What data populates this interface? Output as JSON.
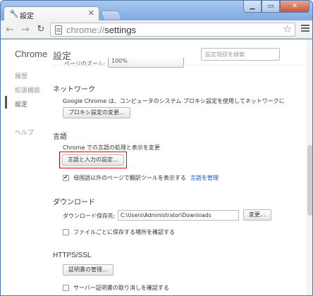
{
  "tab": {
    "title": "設定"
  },
  "toolbar": {
    "url_scheme": "chrome://",
    "url_path": "settings"
  },
  "sidebar": {
    "brand": "Chrome",
    "items": [
      {
        "label": "履歴"
      },
      {
        "label": "拡張機能"
      },
      {
        "label": "設定"
      },
      {
        "label": "ヘルプ"
      }
    ]
  },
  "main": {
    "title": "設定",
    "search_placeholder": "設定項目を検索",
    "clipped_row_label": "ページのズーム:",
    "clipped_row_value": "100%",
    "network": {
      "heading": "ネットワーク",
      "description": "Google Chrome は、コンピュータのシステム プロキシ設定を使用してネットワークに",
      "button": "プロキシ設定の変更..."
    },
    "language": {
      "heading": "言語",
      "description": "Chrome での言語の処理と表示を変更",
      "button": "言語と入力の設定...",
      "translate_label": "母国語以外のページで翻訳ツールを表示する",
      "translate_checked": true,
      "manage_link": "言語を管理"
    },
    "downloads": {
      "heading": "ダウンロード",
      "location_label": "ダウンロード保存先:",
      "location_value": "C:\\Users\\Administrator\\Downloads",
      "change_button": "変更...",
      "ask_label": "ファイルごとに保存する場所を確認する",
      "ask_checked": false
    },
    "https": {
      "heading": "HTTPS/SSL",
      "button": "証明書の管理...",
      "revocation_label": "サーバー証明書の取り消しを確認する",
      "revocation_checked": false
    }
  }
}
